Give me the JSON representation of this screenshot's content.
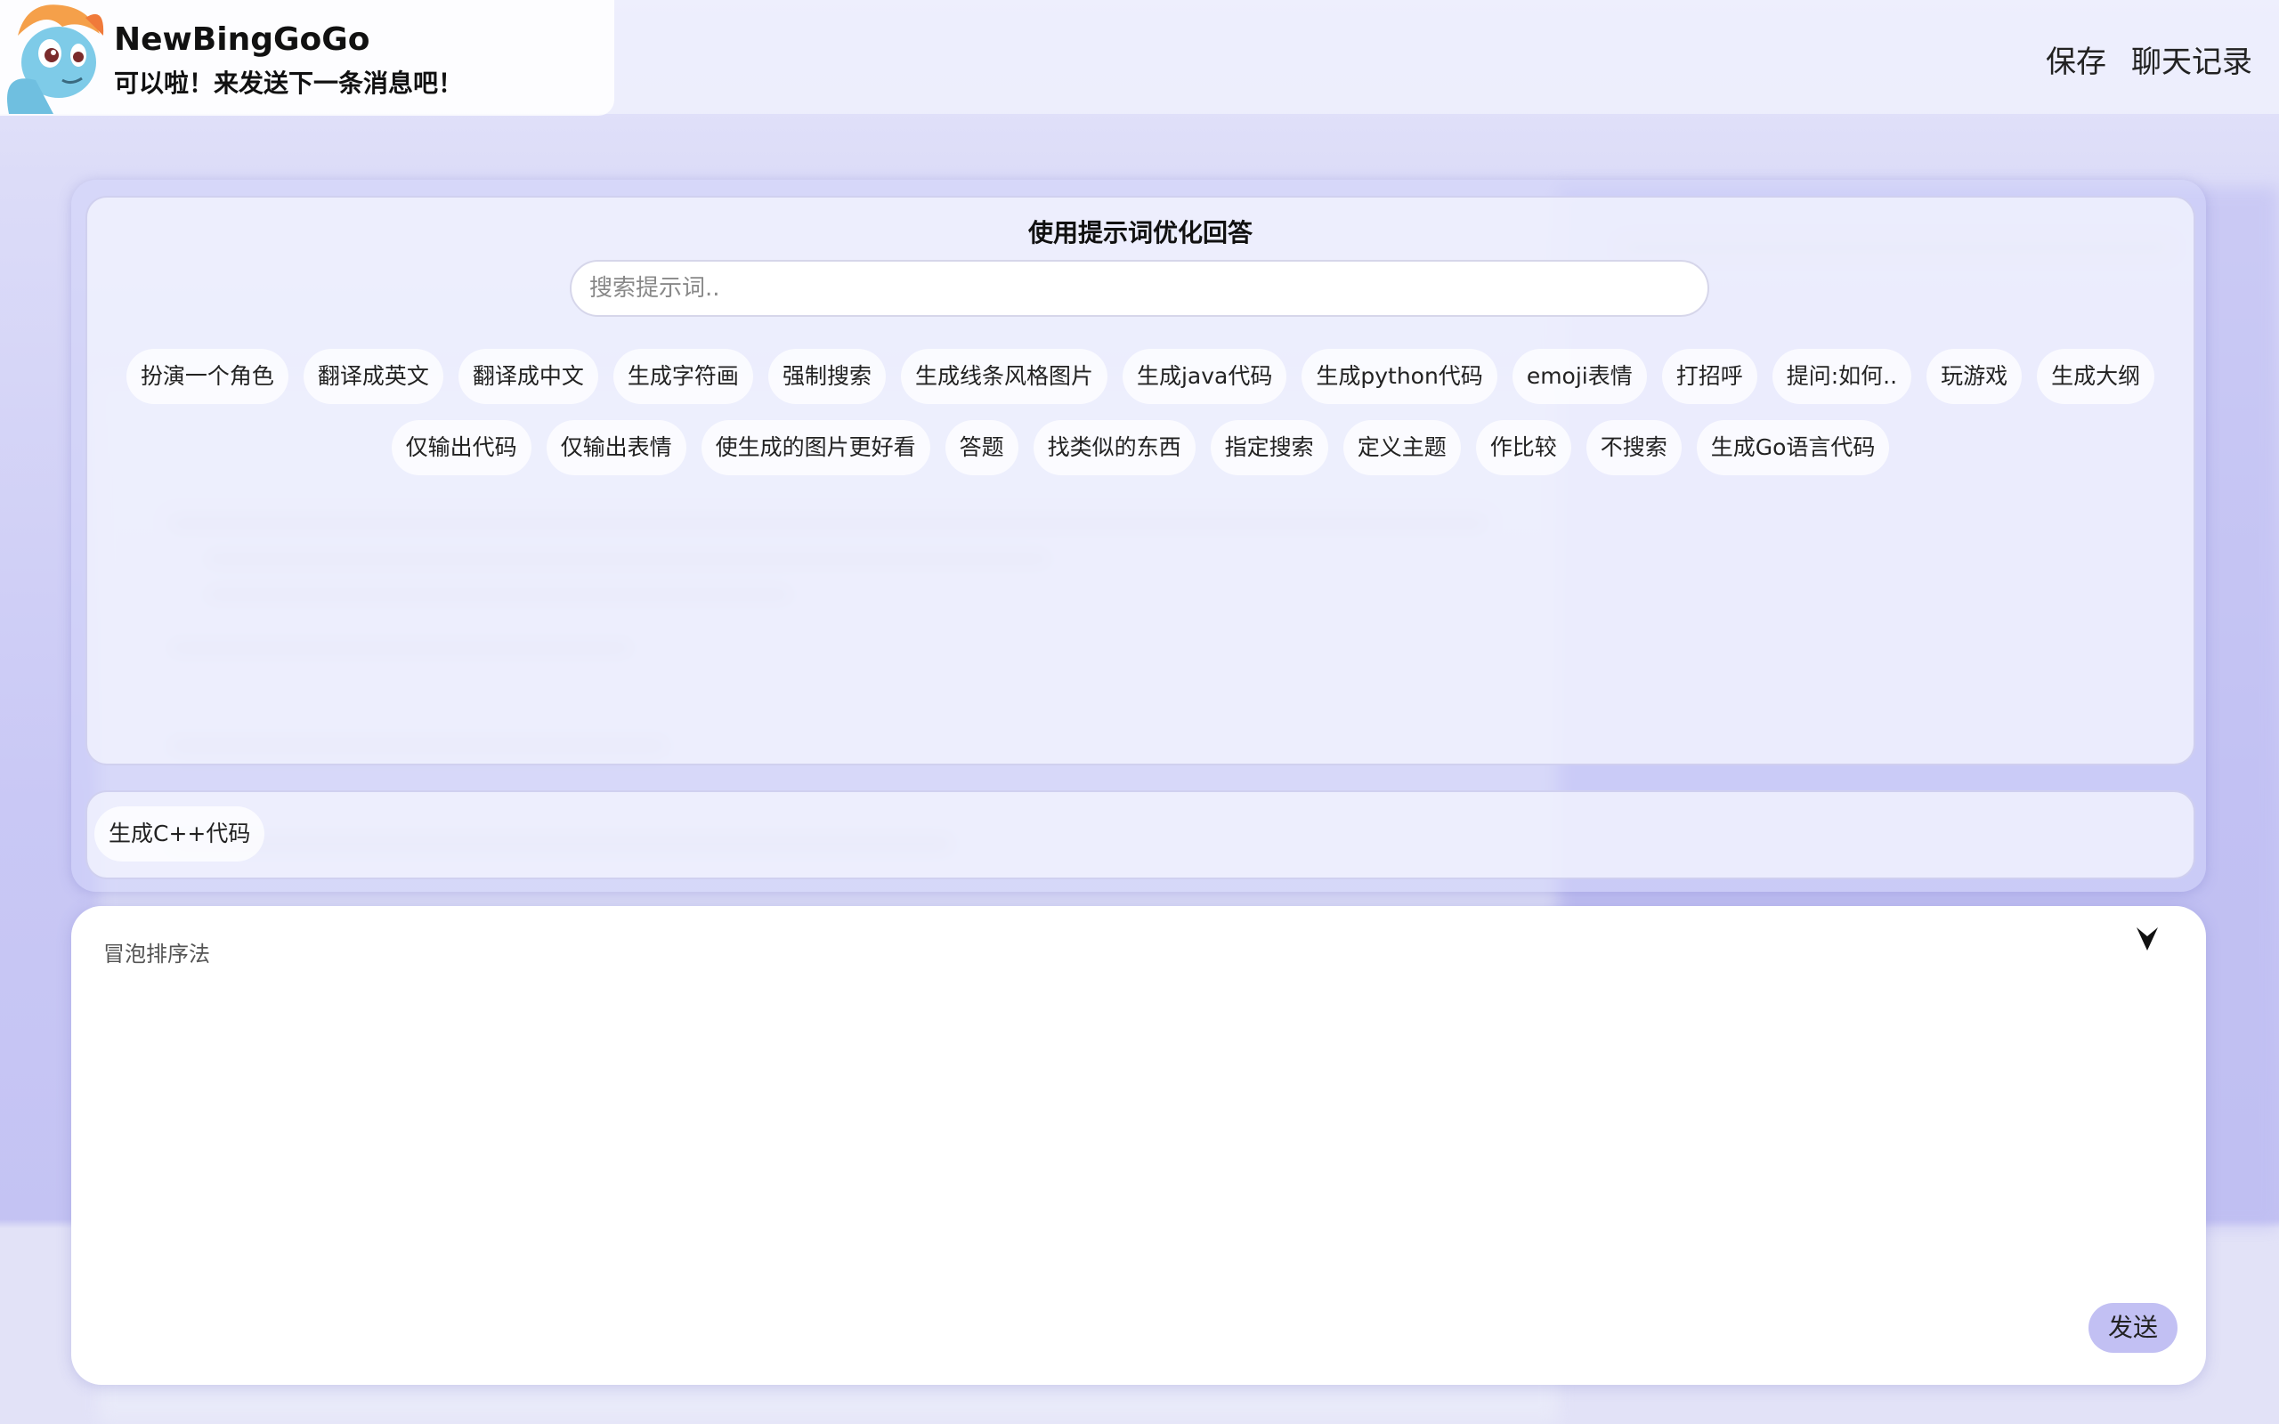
{
  "app": {
    "title": "NewBingGoGo",
    "subtitle": "可以啦！来发送下一条消息吧！",
    "avatar_icon": "pony-avatar-icon"
  },
  "header": {
    "links": [
      {
        "name": "save-link",
        "label": "保存"
      },
      {
        "name": "chat-history-link",
        "label": "聊天记录"
      }
    ]
  },
  "prompt_panel": {
    "title": "使用提示词优化回答",
    "search_placeholder": "搜索提示词..",
    "chips_row1": [
      "扮演一个角色",
      "翻译成英文",
      "翻译成中文",
      "生成字符画",
      "强制搜索",
      "生成线条风格图片",
      "生成java代码",
      "生成python代码",
      "emoji表情",
      "打招呼",
      "提问:如何..",
      "玩游戏",
      "生成大纲"
    ],
    "chips_row2": [
      "仅输出代码",
      "仅输出表情",
      "使生成的图片更好看",
      "答题",
      "找类似的东西",
      "指定搜索",
      "定义主题",
      "作比较",
      "不搜索",
      "生成Go语言代码"
    ],
    "selected_chips": [
      "生成C++代码"
    ]
  },
  "input": {
    "value": "",
    "placeholder": "冒泡排序法",
    "send_label": "发送",
    "collapse_icon": "arrow-down-icon"
  },
  "colors": {
    "accent": "#c2c0f3",
    "background": "#dcdcf8",
    "chip_background": "#ffffff"
  }
}
